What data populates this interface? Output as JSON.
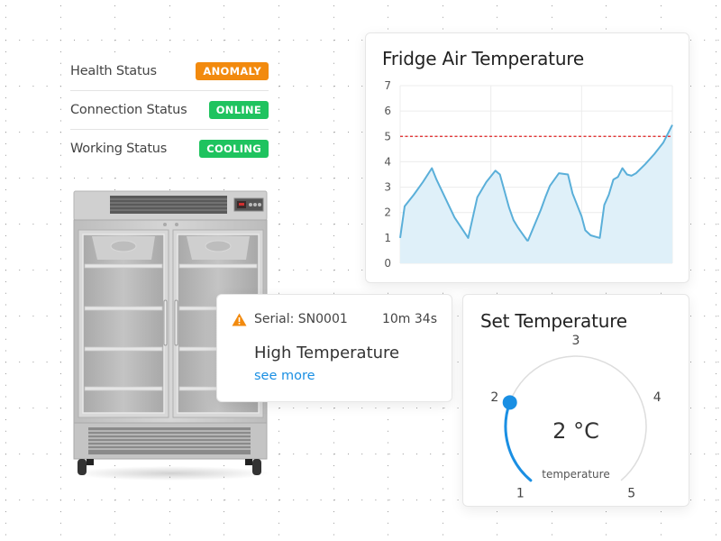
{
  "status": {
    "items": [
      {
        "label": "Health Status",
        "badge": "ANOMALY",
        "color": "#f28a0e"
      },
      {
        "label": "Connection Status",
        "badge": "ONLINE",
        "color": "#1fc35f"
      },
      {
        "label": "Working Status",
        "badge": "COOLING",
        "color": "#1fc35f"
      }
    ]
  },
  "fridge": {
    "display_icon": "fridge-image"
  },
  "chart_card": {
    "title": "Fridge Air Temperature"
  },
  "chart_data": {
    "type": "area",
    "title": "Fridge Air Temperature",
    "xlabel": "",
    "ylabel": "",
    "ylim": [
      0,
      7
    ],
    "yticks": [
      "0",
      "1",
      "2",
      "3",
      "4",
      "5",
      "6",
      "7"
    ],
    "grid": true,
    "threshold": {
      "value": 5,
      "color": "#e02020",
      "style": "dashed"
    },
    "line_color": "#5aafd9",
    "fill_color": "#dff0f9",
    "x": [
      0,
      1,
      3,
      5,
      7,
      8,
      12,
      15,
      17,
      19,
      21,
      22,
      24,
      25,
      26,
      28,
      28.2,
      31,
      32,
      33,
      35,
      37,
      38,
      40,
      40.8,
      42,
      44,
      45,
      46,
      47,
      48,
      49,
      50,
      51,
      52,
      54,
      56,
      58,
      60
    ],
    "values": [
      1.0,
      2.25,
      2.7,
      3.2,
      3.75,
      3.3,
      1.8,
      1.0,
      2.6,
      3.2,
      3.65,
      3.5,
      2.2,
      1.7,
      1.4,
      0.9,
      0.9,
      2.1,
      2.6,
      3.05,
      3.55,
      3.5,
      2.75,
      1.85,
      1.3,
      1.1,
      1.0,
      2.3,
      2.7,
      3.3,
      3.4,
      3.75,
      3.5,
      3.45,
      3.55,
      3.9,
      4.3,
      4.75,
      5.45
    ]
  },
  "alert": {
    "icon": "warning-icon",
    "icon_color": "#f28a0e",
    "serial": "Serial: SN0001",
    "elapsed": "10m 34s",
    "title": "High Temperature",
    "link": "see more"
  },
  "dial_card": {
    "title": "Set Temperature",
    "value_text": "2 °C",
    "caption": "temperature",
    "min": 1,
    "max": 5,
    "value": 2,
    "ticks": [
      "1",
      "2",
      "3",
      "4",
      "5"
    ],
    "accent": "#1a8fe3"
  }
}
